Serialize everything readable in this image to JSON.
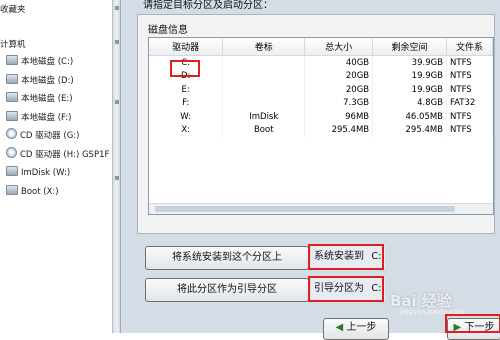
{
  "explorer": {
    "favorites": "收藏夹",
    "computer": "计算机",
    "drives": [
      {
        "label": "本地磁盘 (C:)",
        "kind": "disk"
      },
      {
        "label": "本地磁盘 (D:)",
        "kind": "disk"
      },
      {
        "label": "本地磁盘 (E:)",
        "kind": "disk"
      },
      {
        "label": "本地磁盘 (F:)",
        "kind": "disk"
      },
      {
        "label": "CD 驱动器 (G:)",
        "kind": "cd"
      },
      {
        "label": "CD 驱动器 (H:) GSP1F",
        "kind": "cd"
      },
      {
        "label": "ImDisk (W:)",
        "kind": "disk"
      },
      {
        "label": "Boot (X:)",
        "kind": "disk"
      }
    ]
  },
  "dialog": {
    "prompt": "请指定目标分区及启动分区：",
    "group_title": "磁盘信息",
    "columns": [
      "驱动器",
      "卷标",
      "总大小",
      "剩余空间",
      "文件系"
    ],
    "rows": [
      [
        "C:",
        "",
        "40GB",
        "39.9GB",
        "NTFS"
      ],
      [
        "D:",
        "",
        "20GB",
        "19.9GB",
        "NTFS"
      ],
      [
        "E:",
        "",
        "20GB",
        "19.9GB",
        "NTFS"
      ],
      [
        "F:",
        "",
        "7.3GB",
        "4.8GB",
        "FAT32"
      ],
      [
        "W:",
        "ImDisk",
        "96MB",
        "46.05MB",
        "NTFS"
      ],
      [
        "X:",
        "Boot",
        "295.4MB",
        "295.4MB",
        "NTFS"
      ]
    ],
    "install_button": "将系统安装到这个分区上",
    "install_label": "系统安装到",
    "install_value": "C:",
    "boot_button": "将此分区作为引导分区",
    "boot_label": "引导分区为",
    "boot_value": "C:",
    "prev_button": "上一步",
    "next_button": "下一步"
  },
  "watermark": {
    "text": "Bai 经验",
    "sub": "jingyan.baidu.com"
  },
  "colors": {
    "highlight_box": "#e02020",
    "dialog_bg": "#d4dce6"
  }
}
